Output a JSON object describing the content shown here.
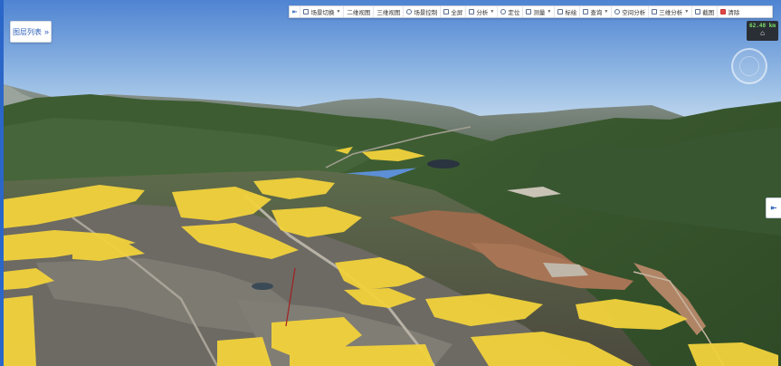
{
  "layer_panel": {
    "label": "图层列表",
    "expand_glyph": "»"
  },
  "toolbar": {
    "toggle_glyph": "⇤",
    "items": [
      {
        "label": "场景切换",
        "icon": "scene-icon",
        "has_caret": true
      },
      {
        "label": "二维视图",
        "icon": "",
        "has_caret": false
      },
      {
        "label": "三维视图",
        "icon": "",
        "has_caret": false
      },
      {
        "label": "场景控制",
        "icon": "camera-icon",
        "has_caret": false
      },
      {
        "label": "全屏",
        "icon": "fullscreen-icon",
        "has_caret": false
      },
      {
        "label": "分析",
        "icon": "analysis-icon",
        "has_caret": true
      },
      {
        "label": "定位",
        "icon": "locate-icon",
        "has_caret": false
      },
      {
        "label": "测量",
        "icon": "measure-icon",
        "has_caret": true
      },
      {
        "label": "标绘",
        "icon": "plot-icon",
        "has_caret": false
      },
      {
        "label": "查询",
        "icon": "query-icon",
        "has_caret": true
      },
      {
        "label": "空间分析",
        "icon": "spatial-icon",
        "has_caret": false
      },
      {
        "label": "三维分析",
        "icon": "3d-analysis-icon",
        "has_caret": true
      },
      {
        "label": "截图",
        "icon": "screenshot-icon",
        "has_caret": false
      },
      {
        "label": "清除",
        "icon": "clear-icon",
        "has_caret": false
      }
    ]
  },
  "status": {
    "value": "62.48 km",
    "home_glyph": "⌂"
  },
  "side_tab": {
    "glyph": "⇤"
  },
  "colors": {
    "highlight": "#f2d23c",
    "sky_top": "#5a8bd4",
    "sky_bottom": "#c9dcef",
    "toolbar_accent": "#2c5fb8"
  }
}
